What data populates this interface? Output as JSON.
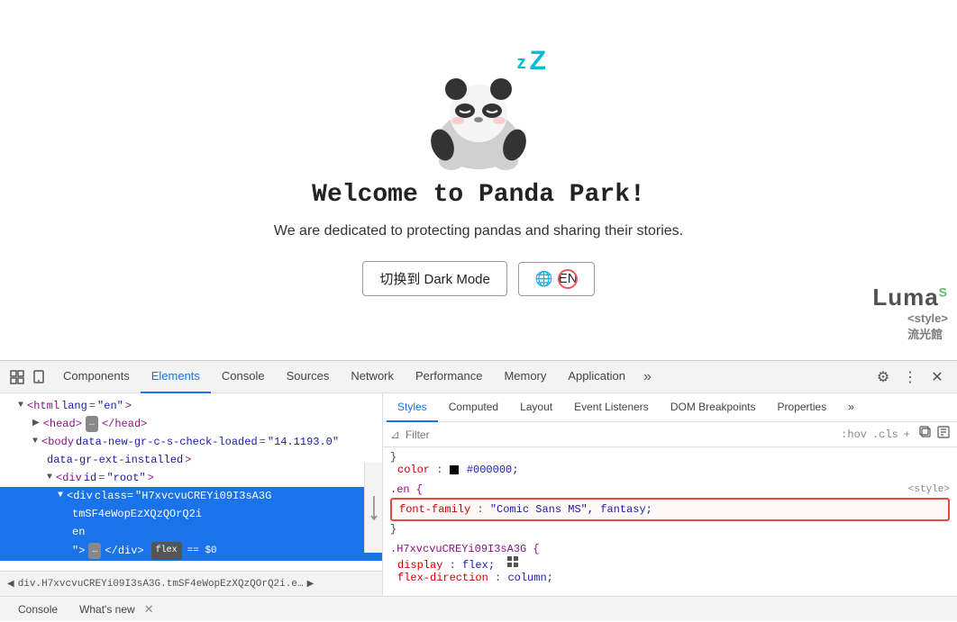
{
  "page": {
    "title": "Panda Park",
    "welcome_title": "Welcome to Panda Park!",
    "welcome_subtitle": "We are dedicated to protecting pandas and sharing their stories.",
    "btn_dark_mode": "切换到 Dark Mode",
    "btn_lang": "EN",
    "panda_zzz1": "z",
    "panda_zzz2": "Z"
  },
  "devtools": {
    "tabs": [
      {
        "label": "Components",
        "active": false
      },
      {
        "label": "Elements",
        "active": true
      },
      {
        "label": "Console",
        "active": false
      },
      {
        "label": "Sources",
        "active": false
      },
      {
        "label": "Network",
        "active": false
      },
      {
        "label": "Performance",
        "active": false
      },
      {
        "label": "Memory",
        "active": false
      },
      {
        "label": "Application",
        "active": false
      },
      {
        "label": "»",
        "active": false
      }
    ],
    "dom_lines": [
      {
        "indent": 1,
        "content": "<html lang=\"en\">"
      },
      {
        "indent": 2,
        "content": "▶ <head>…</head>"
      },
      {
        "indent": 2,
        "content": "▼ <body data-new-gr-c-s-check-loaded=\"14.1193.0\""
      },
      {
        "indent": 3,
        "content": "data-gr-ext-installed>"
      },
      {
        "indent": 3,
        "content": "▼ <div id=\"root\">"
      },
      {
        "indent": 4,
        "content": "▼ <div class=\"H7xvcvuCREYi09I3sA3G"
      },
      {
        "indent": 5,
        "content": "tmSF4eWopEzXQzQOrQ2i"
      },
      {
        "indent": 5,
        "content": "en"
      },
      {
        "indent": 5,
        "content": "\">…</div>"
      }
    ],
    "bottom_breadcrumb": "div.H7xvcvuCREYi09I3sA3G.tmSF4eWopEzXQzQOrQ2i.e…",
    "styles_tabs": [
      "Styles",
      "Computed",
      "Layout",
      "Event Listeners",
      "DOM Breakpoints",
      "Properties",
      "»"
    ],
    "styles_active_tab": "Styles",
    "filter_placeholder": "Filter",
    "filter_hint": ":hov  .cls  +",
    "css_rules": [
      {
        "selector": "",
        "props": [
          {
            "name": "color",
            "value": "■ #000000;"
          }
        ]
      },
      {
        "selector": ".en {",
        "props": [
          {
            "name": "font-family",
            "value": "\"Comic Sans MS\", fantasy;"
          }
        ],
        "highlighted": true,
        "source": "<style>"
      },
      {
        "selector": ".H7xvcvuCREYi09I3sA3G {",
        "props": [
          {
            "name": "display",
            "value": "flex;"
          },
          {
            "name": "flex-direction",
            "value": "column;"
          }
        ],
        "source": ""
      }
    ],
    "bottom_tabs": [
      {
        "label": "Console",
        "closable": false
      },
      {
        "label": "What's new",
        "closable": true
      }
    ]
  }
}
